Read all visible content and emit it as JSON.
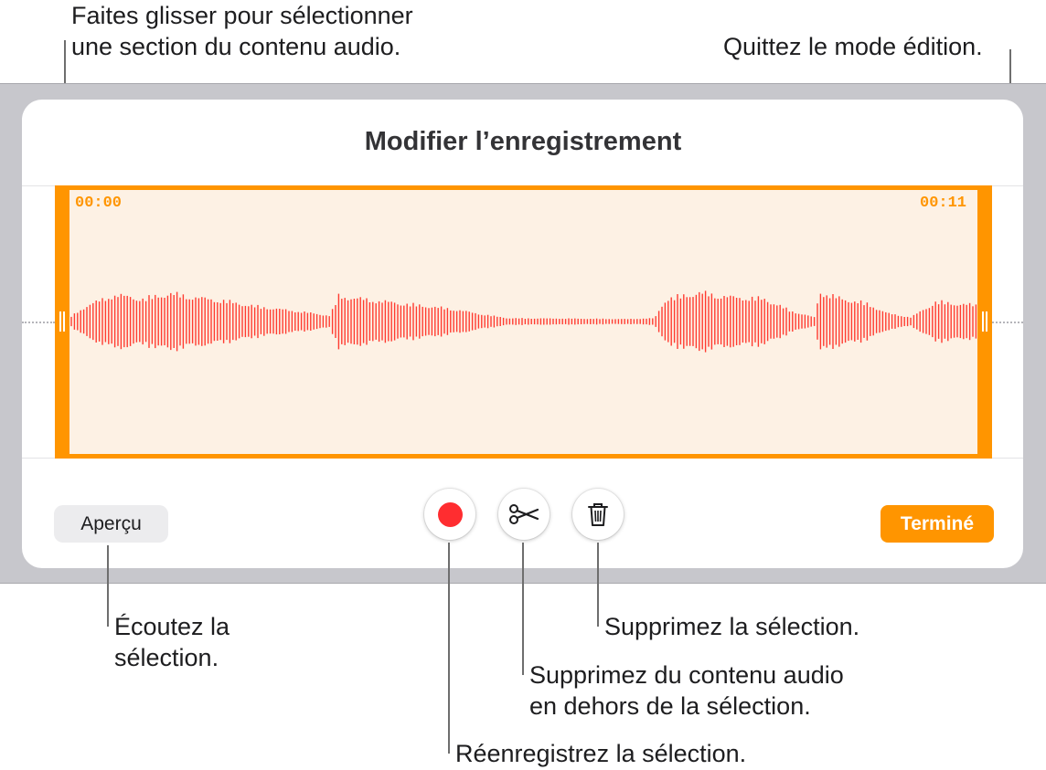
{
  "annotations": {
    "drag_line1": "Faites glisser pour sélectionner",
    "drag_line2": "une section du contenu audio.",
    "quit": "Quittez le mode édition.",
    "listen_line1": "Écoutez la",
    "listen_line2": "sélection.",
    "delete_sel": "Supprimez la sélection.",
    "trim_line1": "Supprimez du contenu audio",
    "trim_line2": "en dehors de la sélection.",
    "rerecord": "Réenregistrez la sélection."
  },
  "editor": {
    "title": "Modifier l’enregistrement",
    "start_time": "00:00",
    "end_time": "00:11",
    "preview_label": "Aperçu",
    "done_label": "Terminé"
  },
  "icons": {
    "record": "record-icon",
    "trim": "scissors-icon",
    "delete": "trash-icon"
  },
  "colors": {
    "accent": "#ff9500",
    "waveform": "#ff3b30",
    "record": "#ff2d30",
    "selection_fill": "#fdf1e4",
    "backdrop": "#c7c7cc"
  }
}
